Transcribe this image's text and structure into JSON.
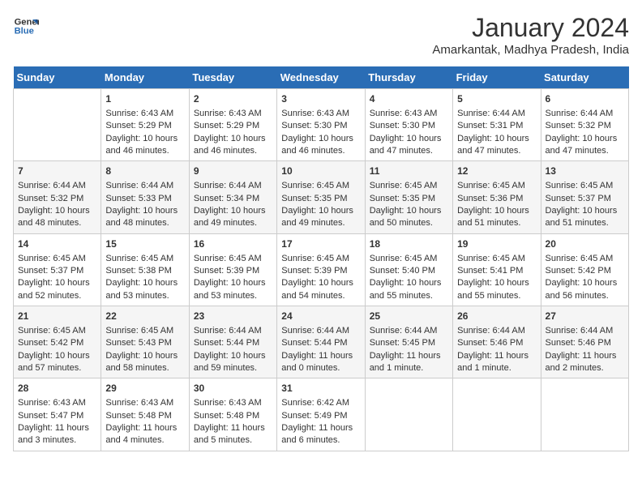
{
  "header": {
    "logo_line1": "General",
    "logo_line2": "Blue",
    "month": "January 2024",
    "location": "Amarkantak, Madhya Pradesh, India"
  },
  "days_of_week": [
    "Sunday",
    "Monday",
    "Tuesday",
    "Wednesday",
    "Thursday",
    "Friday",
    "Saturday"
  ],
  "weeks": [
    [
      {
        "num": "",
        "text": ""
      },
      {
        "num": "1",
        "text": "Sunrise: 6:43 AM\nSunset: 5:29 PM\nDaylight: 10 hours\nand 46 minutes."
      },
      {
        "num": "2",
        "text": "Sunrise: 6:43 AM\nSunset: 5:29 PM\nDaylight: 10 hours\nand 46 minutes."
      },
      {
        "num": "3",
        "text": "Sunrise: 6:43 AM\nSunset: 5:30 PM\nDaylight: 10 hours\nand 46 minutes."
      },
      {
        "num": "4",
        "text": "Sunrise: 6:43 AM\nSunset: 5:30 PM\nDaylight: 10 hours\nand 47 minutes."
      },
      {
        "num": "5",
        "text": "Sunrise: 6:44 AM\nSunset: 5:31 PM\nDaylight: 10 hours\nand 47 minutes."
      },
      {
        "num": "6",
        "text": "Sunrise: 6:44 AM\nSunset: 5:32 PM\nDaylight: 10 hours\nand 47 minutes."
      }
    ],
    [
      {
        "num": "7",
        "text": "Sunrise: 6:44 AM\nSunset: 5:32 PM\nDaylight: 10 hours\nand 48 minutes."
      },
      {
        "num": "8",
        "text": "Sunrise: 6:44 AM\nSunset: 5:33 PM\nDaylight: 10 hours\nand 48 minutes."
      },
      {
        "num": "9",
        "text": "Sunrise: 6:44 AM\nSunset: 5:34 PM\nDaylight: 10 hours\nand 49 minutes."
      },
      {
        "num": "10",
        "text": "Sunrise: 6:45 AM\nSunset: 5:35 PM\nDaylight: 10 hours\nand 49 minutes."
      },
      {
        "num": "11",
        "text": "Sunrise: 6:45 AM\nSunset: 5:35 PM\nDaylight: 10 hours\nand 50 minutes."
      },
      {
        "num": "12",
        "text": "Sunrise: 6:45 AM\nSunset: 5:36 PM\nDaylight: 10 hours\nand 51 minutes."
      },
      {
        "num": "13",
        "text": "Sunrise: 6:45 AM\nSunset: 5:37 PM\nDaylight: 10 hours\nand 51 minutes."
      }
    ],
    [
      {
        "num": "14",
        "text": "Sunrise: 6:45 AM\nSunset: 5:37 PM\nDaylight: 10 hours\nand 52 minutes."
      },
      {
        "num": "15",
        "text": "Sunrise: 6:45 AM\nSunset: 5:38 PM\nDaylight: 10 hours\nand 53 minutes."
      },
      {
        "num": "16",
        "text": "Sunrise: 6:45 AM\nSunset: 5:39 PM\nDaylight: 10 hours\nand 53 minutes."
      },
      {
        "num": "17",
        "text": "Sunrise: 6:45 AM\nSunset: 5:39 PM\nDaylight: 10 hours\nand 54 minutes."
      },
      {
        "num": "18",
        "text": "Sunrise: 6:45 AM\nSunset: 5:40 PM\nDaylight: 10 hours\nand 55 minutes."
      },
      {
        "num": "19",
        "text": "Sunrise: 6:45 AM\nSunset: 5:41 PM\nDaylight: 10 hours\nand 55 minutes."
      },
      {
        "num": "20",
        "text": "Sunrise: 6:45 AM\nSunset: 5:42 PM\nDaylight: 10 hours\nand 56 minutes."
      }
    ],
    [
      {
        "num": "21",
        "text": "Sunrise: 6:45 AM\nSunset: 5:42 PM\nDaylight: 10 hours\nand 57 minutes."
      },
      {
        "num": "22",
        "text": "Sunrise: 6:45 AM\nSunset: 5:43 PM\nDaylight: 10 hours\nand 58 minutes."
      },
      {
        "num": "23",
        "text": "Sunrise: 6:44 AM\nSunset: 5:44 PM\nDaylight: 10 hours\nand 59 minutes."
      },
      {
        "num": "24",
        "text": "Sunrise: 6:44 AM\nSunset: 5:44 PM\nDaylight: 11 hours\nand 0 minutes."
      },
      {
        "num": "25",
        "text": "Sunrise: 6:44 AM\nSunset: 5:45 PM\nDaylight: 11 hours\nand 1 minute."
      },
      {
        "num": "26",
        "text": "Sunrise: 6:44 AM\nSunset: 5:46 PM\nDaylight: 11 hours\nand 1 minute."
      },
      {
        "num": "27",
        "text": "Sunrise: 6:44 AM\nSunset: 5:46 PM\nDaylight: 11 hours\nand 2 minutes."
      }
    ],
    [
      {
        "num": "28",
        "text": "Sunrise: 6:43 AM\nSunset: 5:47 PM\nDaylight: 11 hours\nand 3 minutes."
      },
      {
        "num": "29",
        "text": "Sunrise: 6:43 AM\nSunset: 5:48 PM\nDaylight: 11 hours\nand 4 minutes."
      },
      {
        "num": "30",
        "text": "Sunrise: 6:43 AM\nSunset: 5:48 PM\nDaylight: 11 hours\nand 5 minutes."
      },
      {
        "num": "31",
        "text": "Sunrise: 6:42 AM\nSunset: 5:49 PM\nDaylight: 11 hours\nand 6 minutes."
      },
      {
        "num": "",
        "text": ""
      },
      {
        "num": "",
        "text": ""
      },
      {
        "num": "",
        "text": ""
      }
    ]
  ]
}
